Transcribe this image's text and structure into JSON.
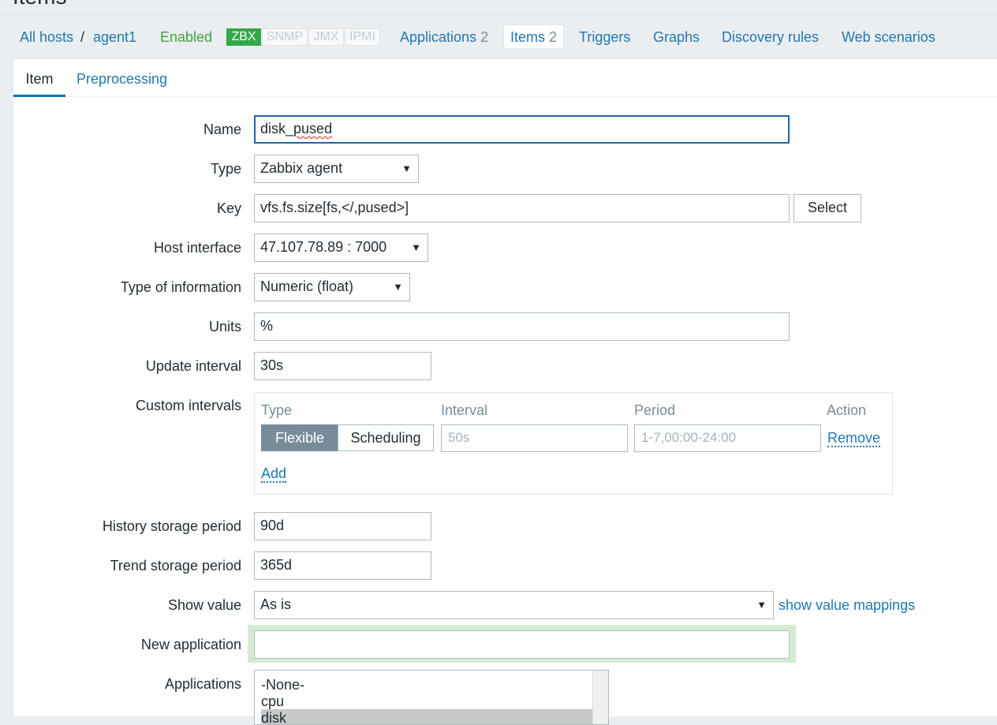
{
  "page": {
    "title": "Items"
  },
  "hostnav": {
    "all_hosts": "All hosts",
    "separator": "/",
    "host": "agent1",
    "status": "Enabled",
    "badges": {
      "zbx": "ZBX",
      "snmp": "SNMP",
      "jmx": "JMX",
      "ipmi": "IPMI"
    },
    "links": {
      "applications": "Applications",
      "applications_count": "2",
      "items": "Items",
      "items_count": "2",
      "triggers": "Triggers",
      "graphs": "Graphs",
      "discovery": "Discovery rules",
      "web": "Web scenarios"
    }
  },
  "tabs": {
    "item": "Item",
    "preprocessing": "Preprocessing"
  },
  "form": {
    "name": {
      "label": "Name",
      "value": "disk_pused",
      "value_pre": "disk_",
      "value_spell": "pused"
    },
    "type": {
      "label": "Type",
      "value": "Zabbix agent"
    },
    "key": {
      "label": "Key",
      "value": "vfs.fs.size[fs,</,pused>]",
      "button": "Select"
    },
    "host_interface": {
      "label": "Host interface",
      "value": "47.107.78.89 : 7000"
    },
    "type_of_information": {
      "label": "Type of information",
      "value": "Numeric (float)"
    },
    "units": {
      "label": "Units",
      "value": "%"
    },
    "update_interval": {
      "label": "Update interval",
      "value": "30s"
    },
    "custom_intervals": {
      "label": "Custom intervals",
      "headers": {
        "type": "Type",
        "interval": "Interval",
        "period": "Period",
        "action": "Action"
      },
      "row": {
        "flexible": "Flexible",
        "scheduling": "Scheduling",
        "interval_placeholder": "50s",
        "period_placeholder": "1-7,00:00-24:00",
        "remove": "Remove"
      },
      "add": "Add"
    },
    "history": {
      "label": "History storage period",
      "value": "90d"
    },
    "trend": {
      "label": "Trend storage period",
      "value": "365d"
    },
    "show_value": {
      "label": "Show value",
      "value": "As is",
      "mappings_link": "show value mappings"
    },
    "new_application": {
      "label": "New application",
      "value": ""
    },
    "applications": {
      "label": "Applications",
      "options": [
        "-None-",
        "cpu",
        "disk"
      ]
    }
  },
  "colors": {
    "link": "#1f77b4",
    "enabled": "#429e47",
    "zbx_badge": "#35a84a",
    "active_tab": "#0275b8",
    "new_app_highlight": "#d4ecd4"
  }
}
